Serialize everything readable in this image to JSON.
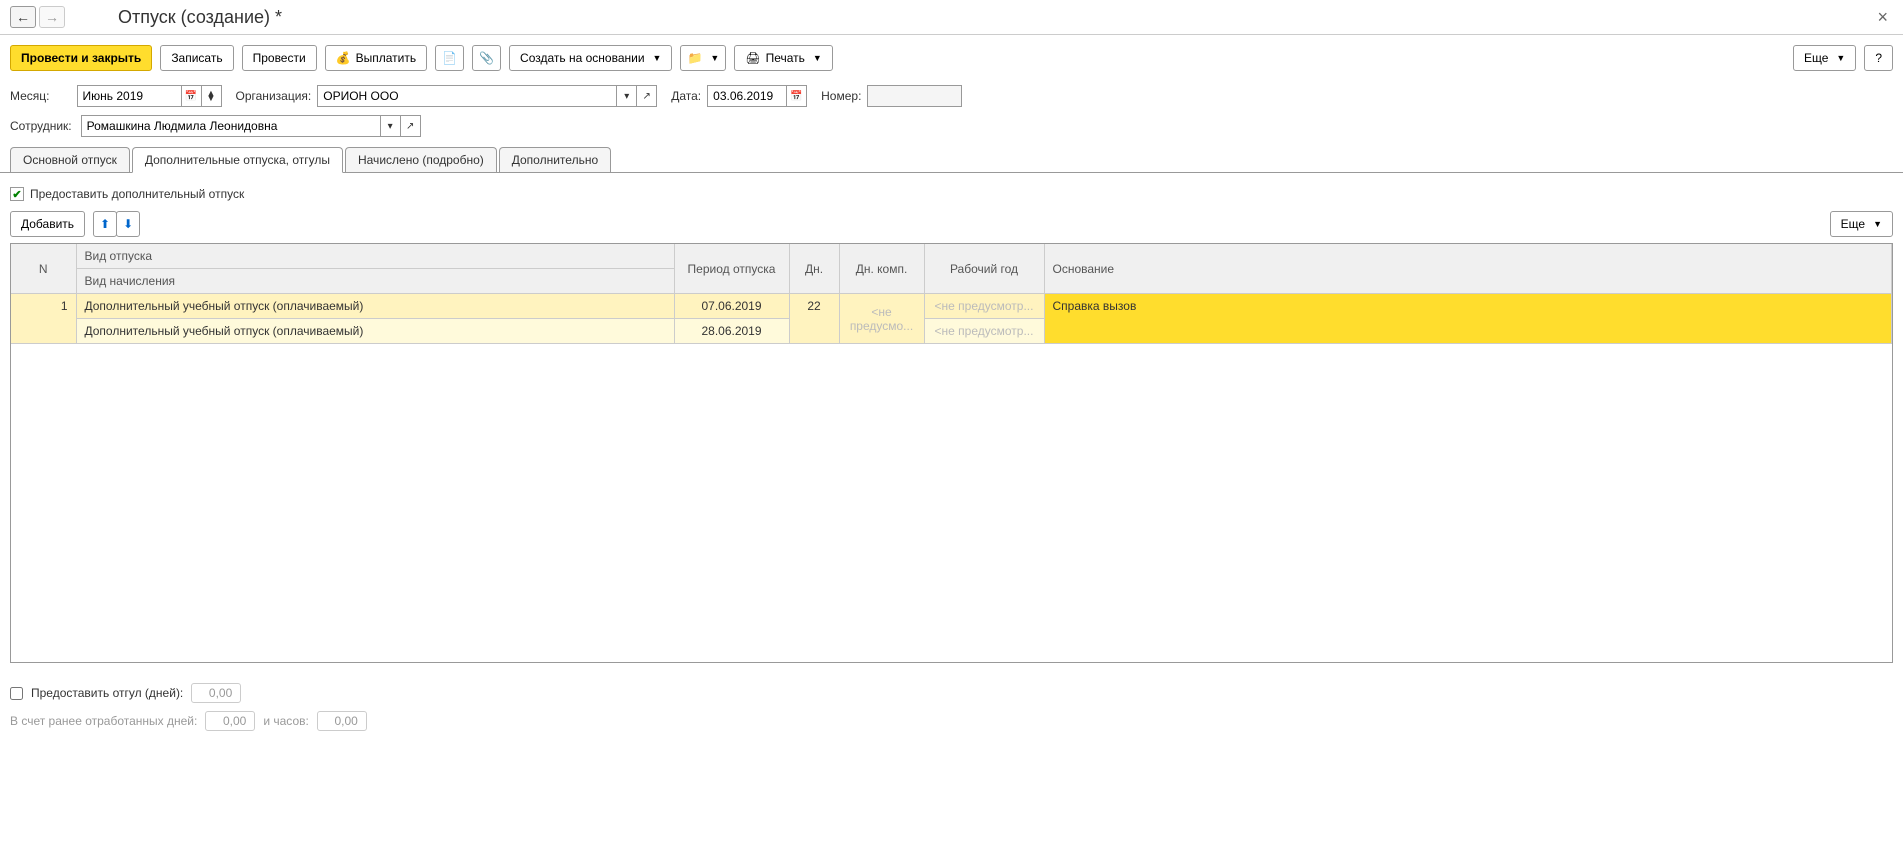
{
  "title": "Отпуск (создание) *",
  "toolbar": {
    "post_close": "Провести и закрыть",
    "save": "Записать",
    "post": "Провести",
    "pay": "Выплатить",
    "create_based": "Создать на основании",
    "print": "Печать",
    "more": "Еще",
    "help": "?"
  },
  "form": {
    "month_label": "Месяц:",
    "month_value": "Июнь 2019",
    "org_label": "Организация:",
    "org_value": "ОРИОН ООО",
    "date_label": "Дата:",
    "date_value": "03.06.2019",
    "number_label": "Номер:",
    "number_value": "",
    "employee_label": "Сотрудник:",
    "employee_value": "Ромашкина Людмила Леонидовна"
  },
  "tabs": {
    "main": "Основной отпуск",
    "additional": "Дополнительные отпуска, отгулы",
    "calculated": "Начислено (подробно)",
    "extra": "Дополнительно"
  },
  "checkbox": {
    "provide_additional": "Предоставить дополнительный отпуск"
  },
  "table_toolbar": {
    "add": "Добавить",
    "more": "Еще"
  },
  "table": {
    "headers": {
      "n": "N",
      "type": "Вид отпуска",
      "accrual": "Вид начисления",
      "period": "Период отпуска",
      "days": "Дн.",
      "comp_days": "Дн. комп.",
      "work_year": "Рабочий год",
      "basis": "Основание"
    },
    "rows": [
      {
        "n": "1",
        "type": "Дополнительный учебный отпуск (оплачиваемый)",
        "accrual": "Дополнительный учебный отпуск (оплачиваемый)",
        "period_from": "07.06.2019",
        "period_to": "28.06.2019",
        "days": "22",
        "comp_days": "<не предусмо...",
        "work_year1": "<не предусмотр...",
        "work_year2": "<не предусмотр...",
        "basis": "Справка вызов"
      }
    ]
  },
  "footer": {
    "provide_dayoff": "Предоставить отгул (дней):",
    "dayoff_value": "0,00",
    "prev_worked_days": "В счет ранее отработанных дней:",
    "prev_days_value": "0,00",
    "and_hours": "и часов:",
    "hours_value": "0,00"
  }
}
